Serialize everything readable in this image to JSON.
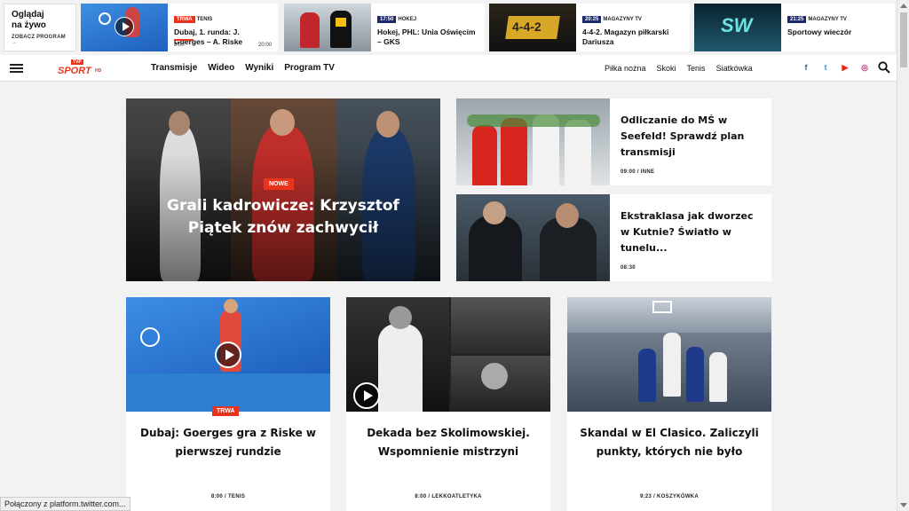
{
  "top_strip": {
    "live_box": {
      "title": "Oglądaj na żywo",
      "link": "ZOBACZ PROGRAM",
      "arrow": "→"
    },
    "cards": [
      {
        "tag": "TRWA",
        "tag_color": "#e8341c",
        "label": "TENIS",
        "title": "Dubaj, 1. runda: J. Goerges – A. Riske",
        "start": "8:00",
        "end": "20:00",
        "play": true
      },
      {
        "tag": "17:50",
        "tag_color": "#1c2a6b",
        "label": "HOKEJ",
        "title": "Hokej, PHL: Unia Oświęcim – GKS",
        "play": false
      },
      {
        "tag": "20:25",
        "tag_color": "#1c2a6b",
        "label": "MAGAZYNY TV",
        "title": "4-4-2. Magazyn piłkarski Dariusza",
        "thumb_text": "4-4-2",
        "play": false
      },
      {
        "tag": "21:25",
        "tag_color": "#1c2a6b",
        "label": "MAGAZYNY TV",
        "title": "Sportowy wieczór",
        "thumb_text": "SW",
        "play": false
      }
    ]
  },
  "nav": {
    "logo": {
      "tvp": "TVP",
      "sport": "SPORT",
      "hd": "HD"
    },
    "menu": [
      "Transmisje",
      "Wideo",
      "Wyniki",
      "Program TV"
    ],
    "categories": [
      "Piłka nożna",
      "Skoki",
      "Tenis",
      "Siatkówka"
    ],
    "social": [
      {
        "icon": "facebook-icon",
        "glyph": "f",
        "color": "#3b5998"
      },
      {
        "icon": "twitter-icon",
        "glyph": "t",
        "color": "#1da1f2"
      },
      {
        "icon": "youtube-icon",
        "glyph": "▶",
        "color": "#e62117"
      },
      {
        "icon": "instagram-icon",
        "glyph": "◎",
        "color": "#c13584"
      }
    ]
  },
  "hero": {
    "badge": "NOWE",
    "headline": "Grali kadrowicze: Krzysztof Piątek znów zachwycił"
  },
  "side_news": [
    {
      "title": "Odliczanie do MŚ w Seefeld! Sprawdź plan transmisji",
      "meta": "09:00 / INNE"
    },
    {
      "title": "Ekstraklasa jak dworzec w Kutnie? Światło w tunelu...",
      "meta": "08:30"
    }
  ],
  "cards": [
    {
      "title": "Dubaj: Goerges gra z Riske w pierwszej rundzie",
      "meta": "8:00 / TENIS",
      "badge": "TRWA",
      "play": true
    },
    {
      "title": "Dekada bez Skolimowskiej. Wspomnienie mistrzyni",
      "meta": "8:00 / LEKKOATLETYKA",
      "play": true
    },
    {
      "title": "Skandal w El Clasico. Zaliczyli punkty, których nie było",
      "meta": "9:23 / KOSZYKÓWKA",
      "play": false
    }
  ],
  "status_bar": "Połączony z platform.twitter.com..."
}
